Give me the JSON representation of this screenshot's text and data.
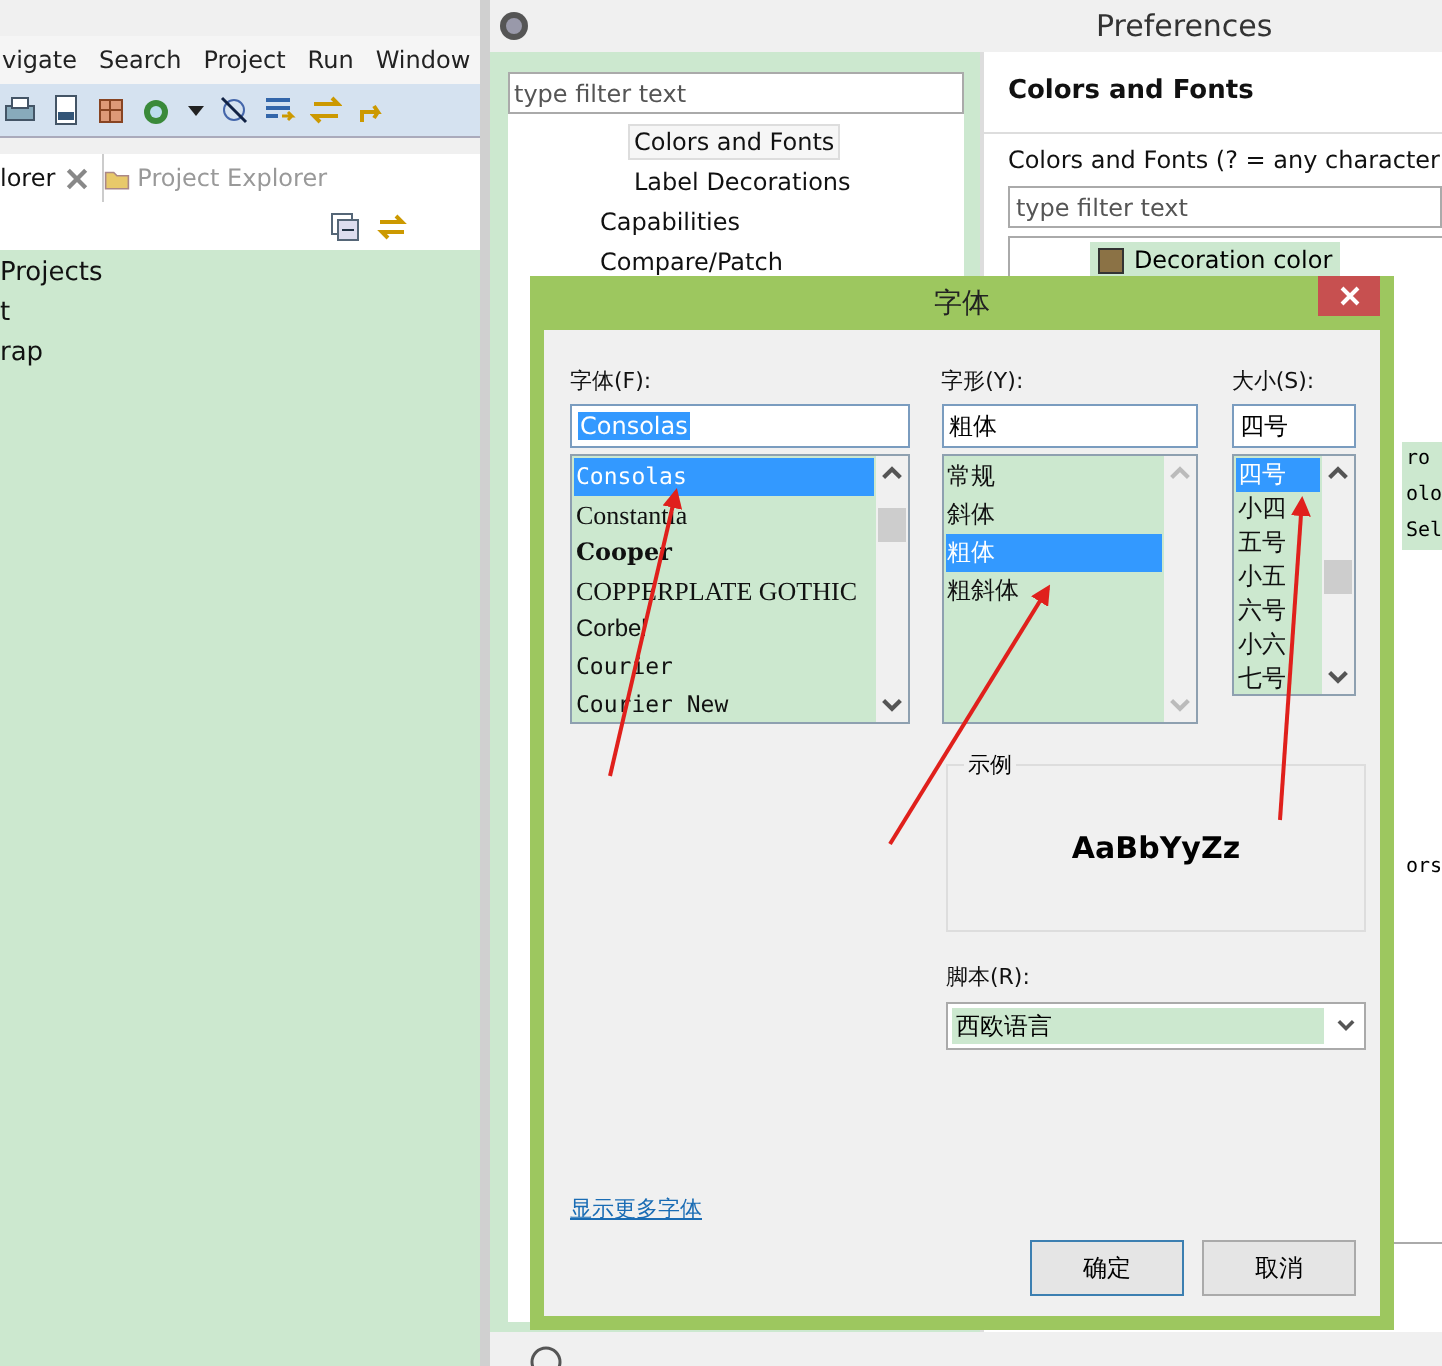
{
  "ide": {
    "menu": [
      "vigate",
      "Search",
      "Project",
      "Run",
      "Window"
    ],
    "tabs": [
      {
        "label": "lorer",
        "selected": true
      },
      {
        "label": "Project Explorer",
        "selected": false
      }
    ],
    "tree": [
      "Projects",
      "t",
      "rap"
    ]
  },
  "preferences": {
    "title": "Preferences",
    "filter_placeholder": "type filter text",
    "nav": {
      "children": [
        {
          "label": "Colors and Fonts",
          "selected": true
        },
        {
          "label": "Label Decorations",
          "selected": false
        }
      ],
      "items": [
        {
          "label": "Capabilities",
          "selected": false
        },
        {
          "label": "Compare/Patch",
          "selected": false
        }
      ]
    },
    "page_title": "Colors and Fonts",
    "tree_label": "Colors and Fonts (? = any character",
    "tree_filter_placeholder": "type filter text",
    "tree_items": [
      {
        "label": "Decoration color",
        "color": "#8b7245"
      }
    ],
    "peek_texts": [
      "ro",
      "olo",
      "Sel",
      "ors"
    ]
  },
  "font_dialog": {
    "title": "字体",
    "font_label": "字体(F):",
    "font_value": "Consolas",
    "fonts": [
      {
        "label": "Consolas",
        "kind": "mono",
        "selected": true
      },
      {
        "label": "Constantia",
        "kind": "serif",
        "selected": false
      },
      {
        "label": "Cooper",
        "kind": "bold",
        "selected": false
      },
      {
        "label": "COPPERPLATE GOTHIC",
        "kind": "serif",
        "selected": false
      },
      {
        "label": "Corbel",
        "kind": "sans",
        "selected": false
      },
      {
        "label": "Courier",
        "kind": "mono",
        "selected": false
      },
      {
        "label": "Courier New",
        "kind": "mono",
        "selected": false
      }
    ],
    "style_label": "字形(Y):",
    "style_value": "粗体",
    "styles": [
      {
        "label": "常规",
        "selected": false
      },
      {
        "label": "斜体",
        "selected": false
      },
      {
        "label": "粗体",
        "selected": true
      },
      {
        "label": "粗斜体",
        "selected": false
      }
    ],
    "size_label": "大小(S):",
    "size_value": "四号",
    "sizes": [
      {
        "label": "四号",
        "selected": true
      },
      {
        "label": "小四",
        "selected": false
      },
      {
        "label": "五号",
        "selected": false
      },
      {
        "label": "小五",
        "selected": false
      },
      {
        "label": "六号",
        "selected": false
      },
      {
        "label": "小六",
        "selected": false
      },
      {
        "label": "七号",
        "selected": false
      }
    ],
    "sample_label": "示例",
    "sample_text": "AaBbYyZz",
    "script_label": "脚本(R):",
    "script_value": "西欧语言",
    "more_fonts_link": "显示更多字体",
    "buttons": [
      "确定",
      "取消"
    ]
  }
}
